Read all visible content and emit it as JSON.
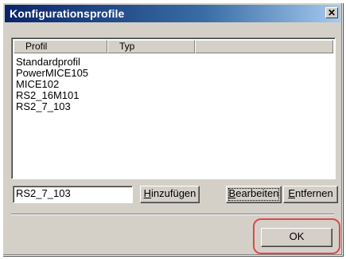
{
  "window": {
    "title": "Konfigurationsprofile",
    "close_glyph": "✕"
  },
  "list": {
    "columns": [
      "Profil",
      "Typ"
    ],
    "items": [
      "Standardprofil",
      "PowerMICE105",
      "MICE102",
      "RS2_16M101",
      "RS2_7_103"
    ]
  },
  "profile_name": {
    "value": "RS2_7_103"
  },
  "buttons": {
    "add": {
      "label_u": "H",
      "label_rest": "inzufügen"
    },
    "edit": {
      "label_u": "B",
      "label_rest": "earbeiten"
    },
    "remove": {
      "label_u": "E",
      "label_rest": "ntfernen"
    },
    "ok": "OK"
  },
  "annotation": {
    "ring_color": "#e04848"
  }
}
